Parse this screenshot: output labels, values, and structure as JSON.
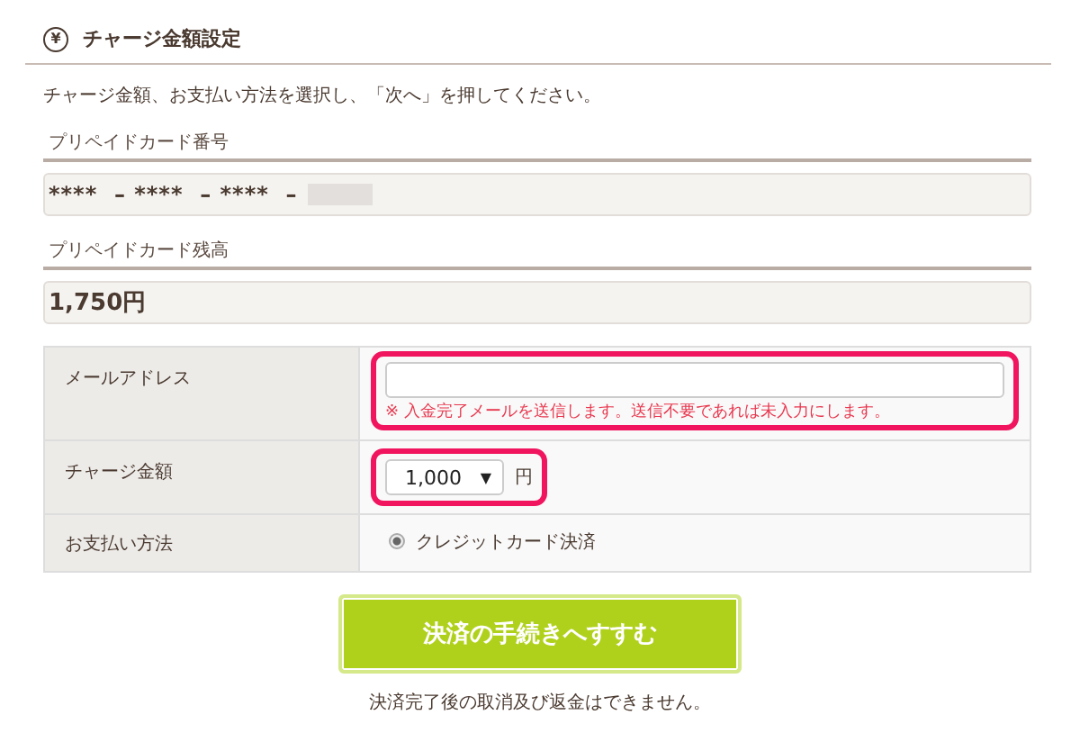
{
  "header": {
    "icon_text": "¥",
    "title": "チャージ金額設定"
  },
  "instruction": "チャージ金額、お支払い方法を選択し、「次へ」を押してください。",
  "card_number": {
    "label": "プリペイドカード番号",
    "value": "****  – ****  – ****  –"
  },
  "balance": {
    "label": "プリペイドカード残高",
    "value": "1,750円"
  },
  "form": {
    "rows": [
      {
        "kind": "email",
        "label": "メールアドレス",
        "note": "※ 入金完了メールを送信します。送信不要であれば未入力にします。",
        "highlighted": true
      },
      {
        "kind": "amount",
        "label": "チャージ金額",
        "value": "1,000",
        "caret": "▼",
        "unit": "円",
        "highlighted": true
      },
      {
        "kind": "payment",
        "label": "お支払い方法",
        "options": [
          {
            "label": "クレジットカード決済",
            "selected": true
          }
        ]
      }
    ]
  },
  "submit_button": "決済の手続きへすすむ",
  "footnote": "決済完了後の取消及び返金はできません。"
}
